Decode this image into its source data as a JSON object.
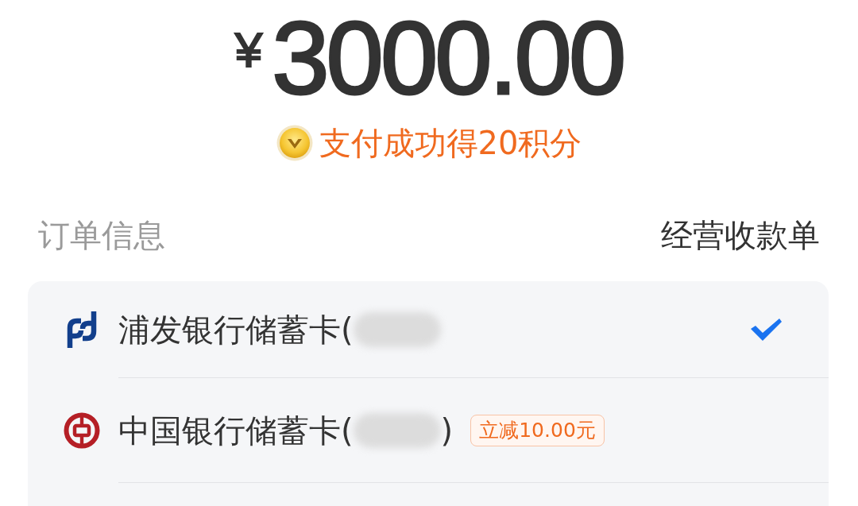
{
  "amount": {
    "currency": "¥",
    "value": "3000.00"
  },
  "reward": {
    "text": "支付成功得20积分"
  },
  "order_info": {
    "label": "订单信息",
    "value": "经营收款单"
  },
  "payment_methods": [
    {
      "kind": "spdb",
      "label": "浦发银行储蓄卡(",
      "redacted": true,
      "selected": true
    },
    {
      "kind": "boc",
      "label": "中国银行储蓄卡(",
      "redacted": true,
      "suffix": ")",
      "badge": "立减10.00元",
      "selected": false
    }
  ]
}
